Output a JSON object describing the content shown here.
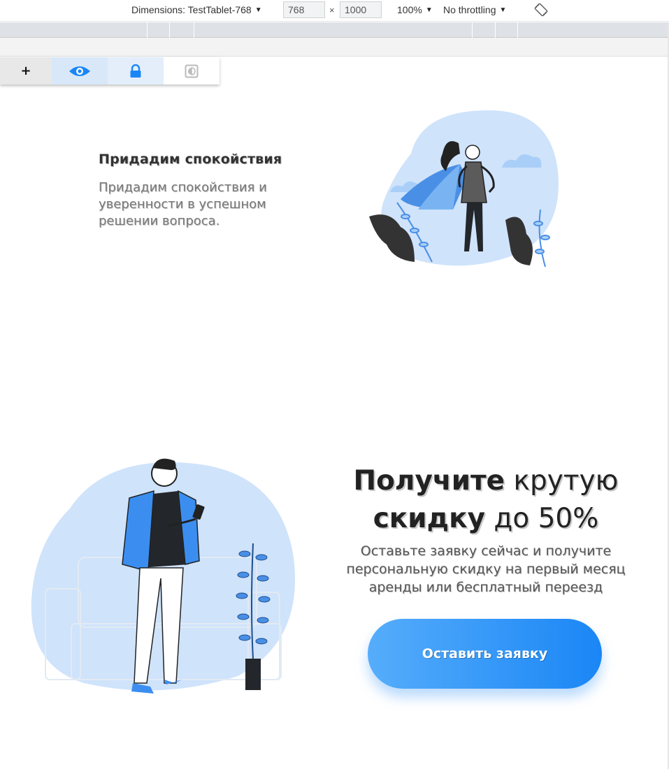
{
  "devtools": {
    "device_label": "Dimensions: TestTablet-768",
    "width_value": "768",
    "height_value": "1000",
    "times_sign": "×",
    "zoom": "100%",
    "throttle": "No throttling",
    "caret": "▼"
  },
  "tool_panel": {
    "add_symbol": "+",
    "icons": [
      "plus-icon",
      "eye-icon",
      "lock-icon",
      "contrast-icon"
    ]
  },
  "feature": {
    "title": "Придадим спокойствия",
    "text": "Придадим спокойствия и уверенности в успешном решении вопроса."
  },
  "promo": {
    "title_bold_1": "Получите",
    "title_rest_1": " крутую",
    "title_bold_2": "скидку",
    "title_rest_2": " до 50%",
    "text": "Оставьте заявку сейчас и получите персональную скидку на первый месяц аренды или бесплатный переезд",
    "button_label": "Оставить заявку"
  },
  "colors": {
    "accent": "#1a86f5",
    "accent_light": "#56adfb",
    "illustration_blue": "#cfe3fb"
  }
}
